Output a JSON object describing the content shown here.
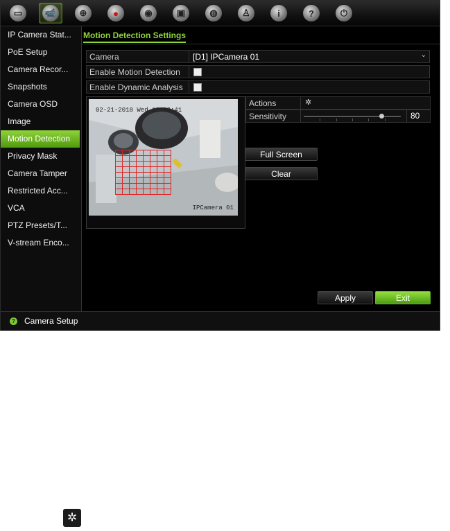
{
  "toolbar": {
    "icons": [
      {
        "name": "monitor-icon",
        "glyph": "▭"
      },
      {
        "name": "camera-icon",
        "glyph": "📹"
      },
      {
        "name": "network-icon",
        "glyph": "⊕"
      },
      {
        "name": "record-icon",
        "glyph": "●"
      },
      {
        "name": "alarm-icon",
        "glyph": "◉"
      },
      {
        "name": "device-icon",
        "glyph": "▣"
      },
      {
        "name": "hdd-icon",
        "glyph": "◍"
      },
      {
        "name": "user-icon",
        "glyph": "♙"
      },
      {
        "name": "info-icon",
        "glyph": "i"
      },
      {
        "name": "help-icon",
        "glyph": "?"
      },
      {
        "name": "power-icon",
        "glyph": "⏻"
      }
    ],
    "active_icon": "camera-icon"
  },
  "sidebar": {
    "items": [
      {
        "label": "IP Camera Stat..."
      },
      {
        "label": "PoE Setup"
      },
      {
        "label": "Camera Recor..."
      },
      {
        "label": "Snapshots"
      },
      {
        "label": "Camera OSD"
      },
      {
        "label": "Image"
      },
      {
        "label": "Motion Detection"
      },
      {
        "label": "Privacy Mask"
      },
      {
        "label": "Camera Tamper"
      },
      {
        "label": "Restricted Acc..."
      },
      {
        "label": "VCA"
      },
      {
        "label": "PTZ Presets/T..."
      },
      {
        "label": "V-stream Enco..."
      }
    ],
    "selected": "Motion Detection"
  },
  "main": {
    "tab_title": "Motion Detection Settings",
    "camera": {
      "label": "Camera",
      "value": "[D1] IPCamera 01"
    },
    "enable_motion": {
      "label": "Enable Motion Detection",
      "checked": false
    },
    "enable_dynamic": {
      "label": "Enable Dynamic Analysis",
      "checked": false
    },
    "preview": {
      "osd_datetime": "02-21-2018 Wed 12:03:41",
      "osd_camera_name": "IPCamera 01",
      "grid_color": "#e02020"
    },
    "actions": {
      "label": "Actions",
      "icon": "gear-icon"
    },
    "sensitivity": {
      "label": "Sensitivity",
      "value": "80",
      "fraction": 0.8
    },
    "full_screen_label": "Full Screen",
    "clear_label": "Clear",
    "apply_label": "Apply",
    "exit_label": "Exit"
  },
  "statusbar": {
    "text": "Camera Setup",
    "icon": "help-icon"
  },
  "colors": {
    "accent": "#8ed43a",
    "selected_bg": "#6cb520",
    "grid": "#e02020"
  },
  "lone_icon": {
    "name": "gear-icon",
    "glyph": "✲"
  }
}
